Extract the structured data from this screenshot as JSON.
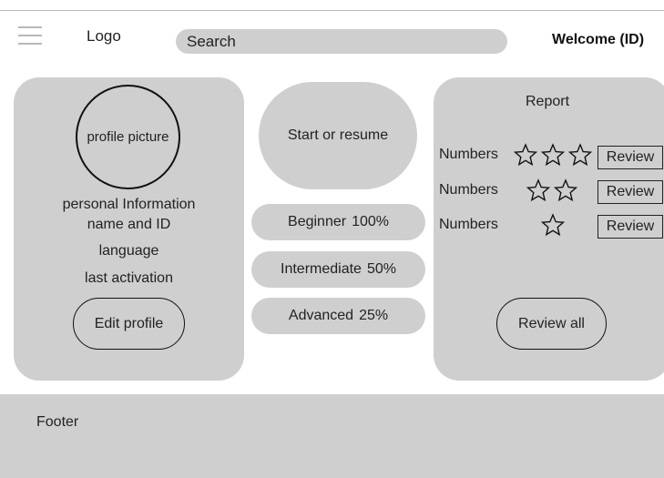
{
  "header": {
    "menu_icon": "hamburger-menu-icon",
    "logo": "Logo",
    "search_text": "Search",
    "welcome": "Welcome (ID)"
  },
  "profile": {
    "picture_label": "profile picture",
    "personal_info": "personal Information",
    "name_id": "name and ID",
    "language": "language",
    "last_activation": "last activation",
    "edit_button": "Edit profile"
  },
  "main": {
    "start_button": "Start or resume",
    "levels": [
      {
        "name": "Beginner",
        "progress": "100%"
      },
      {
        "name": "Intermediate",
        "progress": "50%"
      },
      {
        "name": "Advanced",
        "progress": "25%"
      }
    ]
  },
  "report": {
    "title": "Report",
    "rows": [
      {
        "label": "Numbers",
        "stars": 3,
        "review": "Review"
      },
      {
        "label": "Numbers",
        "stars": 2,
        "review": "Review"
      },
      {
        "label": "Numbers",
        "stars": 1,
        "review": "Review"
      }
    ],
    "review_all": "Review all"
  },
  "footer": {
    "label": "Footer"
  },
  "colors": {
    "panel": "#cfcfcf",
    "outline": "#111111",
    "rule": "#bdbdbd"
  }
}
